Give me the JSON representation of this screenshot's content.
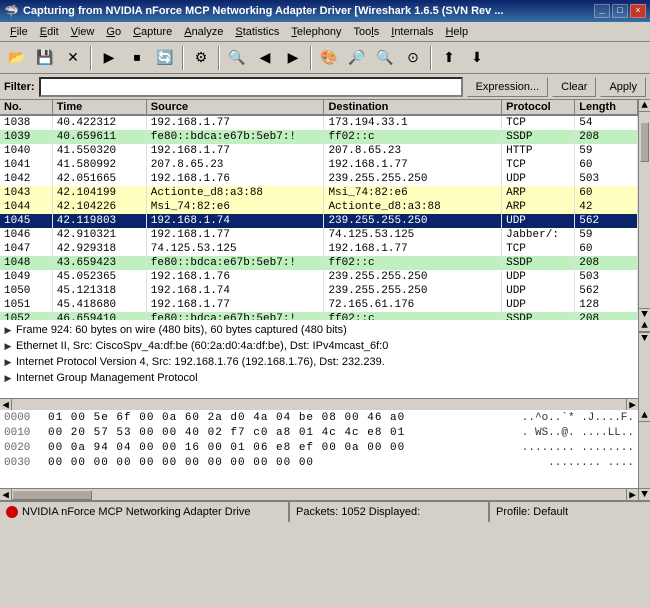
{
  "titleBar": {
    "title": "Capturing from NVIDIA nForce MCP Networking Adapter Driver  [Wireshark 1.6.5 (SVN Rev ...",
    "icon": "🦈",
    "controls": [
      "_",
      "□",
      "×"
    ]
  },
  "menuBar": {
    "items": [
      {
        "label": "File",
        "underline": 0
      },
      {
        "label": "Edit",
        "underline": 0
      },
      {
        "label": "View",
        "underline": 0
      },
      {
        "label": "Go",
        "underline": 0
      },
      {
        "label": "Capture",
        "underline": 0
      },
      {
        "label": "Analyze",
        "underline": 0
      },
      {
        "label": "Statistics",
        "underline": 0
      },
      {
        "label": "Telephony",
        "underline": 0
      },
      {
        "label": "Tools",
        "underline": 0
      },
      {
        "label": "Internals",
        "underline": 0
      },
      {
        "label": "Help",
        "underline": 0
      }
    ]
  },
  "toolbar": {
    "icons": [
      "📂",
      "💾",
      "✕",
      "◀",
      "▶",
      "🔄",
      "🖨",
      "✂",
      "📋",
      "🔍",
      "◀▶",
      "⏩",
      "⬆",
      "⬇",
      "📦",
      "📊",
      "🔍",
      "🔎",
      "🔍"
    ]
  },
  "filterBar": {
    "label": "Filter:",
    "value": "",
    "placeholder": "",
    "expressionBtn": "Expression...",
    "clearBtn": "Clear",
    "applyBtn": "Apply"
  },
  "packetList": {
    "columns": [
      "No.",
      "Time",
      "Source",
      "Destination",
      "Protocol",
      "Length"
    ],
    "rows": [
      {
        "no": "1038",
        "time": "40.422312",
        "src": "192.168.1.77",
        "dst": "173.194.33.1",
        "proto": "TCP",
        "len": "54",
        "style": "normal"
      },
      {
        "no": "1039",
        "time": "40.659611",
        "src": "fe80::bdca:e67b:5eb7:!",
        "dst": "ff02::c",
        "proto": "SSDP",
        "len": "208",
        "style": "ssdp"
      },
      {
        "no": "1040",
        "time": "41.550320",
        "src": "192.168.1.77",
        "dst": "207.8.65.23",
        "proto": "HTTP",
        "len": "59",
        "style": "normal"
      },
      {
        "no": "1041",
        "time": "41.580992",
        "src": "207.8.65.23",
        "dst": "192.168.1.77",
        "proto": "TCP",
        "len": "60",
        "style": "normal"
      },
      {
        "no": "1042",
        "time": "42.051665",
        "src": "192.168.1.76",
        "dst": "239.255.255.250",
        "proto": "UDP",
        "len": "503",
        "style": "normal"
      },
      {
        "no": "1043",
        "time": "42.104199",
        "src": "Actionte_d8:a3:88",
        "dst": "Msi_74:82:e6",
        "proto": "ARP",
        "len": "60",
        "style": "arp"
      },
      {
        "no": "1044",
        "time": "42.104226",
        "src": "Msi_74:82:e6",
        "dst": "Actionte_d8:a3:88",
        "proto": "ARP",
        "len": "42",
        "style": "arp"
      },
      {
        "no": "1045",
        "time": "42.119803",
        "src": "192.168.1.74",
        "dst": "239.255.255.250",
        "proto": "UDP",
        "len": "562",
        "style": "selected"
      },
      {
        "no": "1046",
        "time": "42.910321",
        "src": "192.168.1.77",
        "dst": "74.125.53.125",
        "proto": "Jabber/:",
        "len": "59",
        "style": "normal"
      },
      {
        "no": "1047",
        "time": "42.929318",
        "src": "74.125.53.125",
        "dst": "192.168.1.77",
        "proto": "TCP",
        "len": "60",
        "style": "normal"
      },
      {
        "no": "1048",
        "time": "43.659423",
        "src": "fe80::bdca:e67b:5eb7:!",
        "dst": "ff02::c",
        "proto": "SSDP",
        "len": "208",
        "style": "ssdp"
      },
      {
        "no": "1049",
        "time": "45.052365",
        "src": "192.168.1.76",
        "dst": "239.255.255.250",
        "proto": "UDP",
        "len": "503",
        "style": "normal"
      },
      {
        "no": "1050",
        "time": "45.121318",
        "src": "192.168.1.74",
        "dst": "239.255.255.250",
        "proto": "UDP",
        "len": "562",
        "style": "normal"
      },
      {
        "no": "1051",
        "time": "45.418680",
        "src": "192.168.1.77",
        "dst": "72.165.61.176",
        "proto": "UDP",
        "len": "128",
        "style": "normal"
      },
      {
        "no": "1052",
        "time": "46.659410",
        "src": "fe80::bdca:e67b:5eb7:!",
        "dst": "ff02::c",
        "proto": "SSDP",
        "len": "208",
        "style": "ssdp"
      }
    ]
  },
  "packetDetail": {
    "lines": [
      "Frame 924: 60 bytes on wire (480 bits), 60 bytes captured (480 bits)",
      "Ethernet II, Src: CiscoSpv_4a:df:be (60:2a:d0:4a:df:be), Dst: IPv4mcast_6f:0",
      "Internet Protocol Version 4, Src: 192.168.1.76 (192.168.1.76), Dst: 232.239.0",
      "Internet Group Management Protocol"
    ]
  },
  "hexDump": {
    "lines": [
      {
        "offset": "0000",
        "bytes": "01 00 5e 6f 00 0a 60 2a  d0 4a 04 be 08 00 46 a0",
        "ascii": "..^o..`* .J....F."
      },
      {
        "offset": "0010",
        "bytes": "00 20 57 53 00 00 40 02  f7 c0 a8 01 4c 4c e8 01",
        "ascii": ". WS..@. ....LL.."
      },
      {
        "offset": "0020",
        "bytes": "00 0a 94 04 00 00 16 00  01 06 e8 ef 00 0a 00 00",
        "ascii": "........ ........"
      },
      {
        "offset": "0030",
        "bytes": "00 00 00 00 00 00 00 00  00 00 00 00",
        "ascii": "........ ...."
      }
    ]
  },
  "statusBar": {
    "adapter": "NVIDIA nForce MCP Networking Adapter Drive",
    "packets": "Packets: 1052 Displayed:",
    "profile": "Profile: Default"
  }
}
